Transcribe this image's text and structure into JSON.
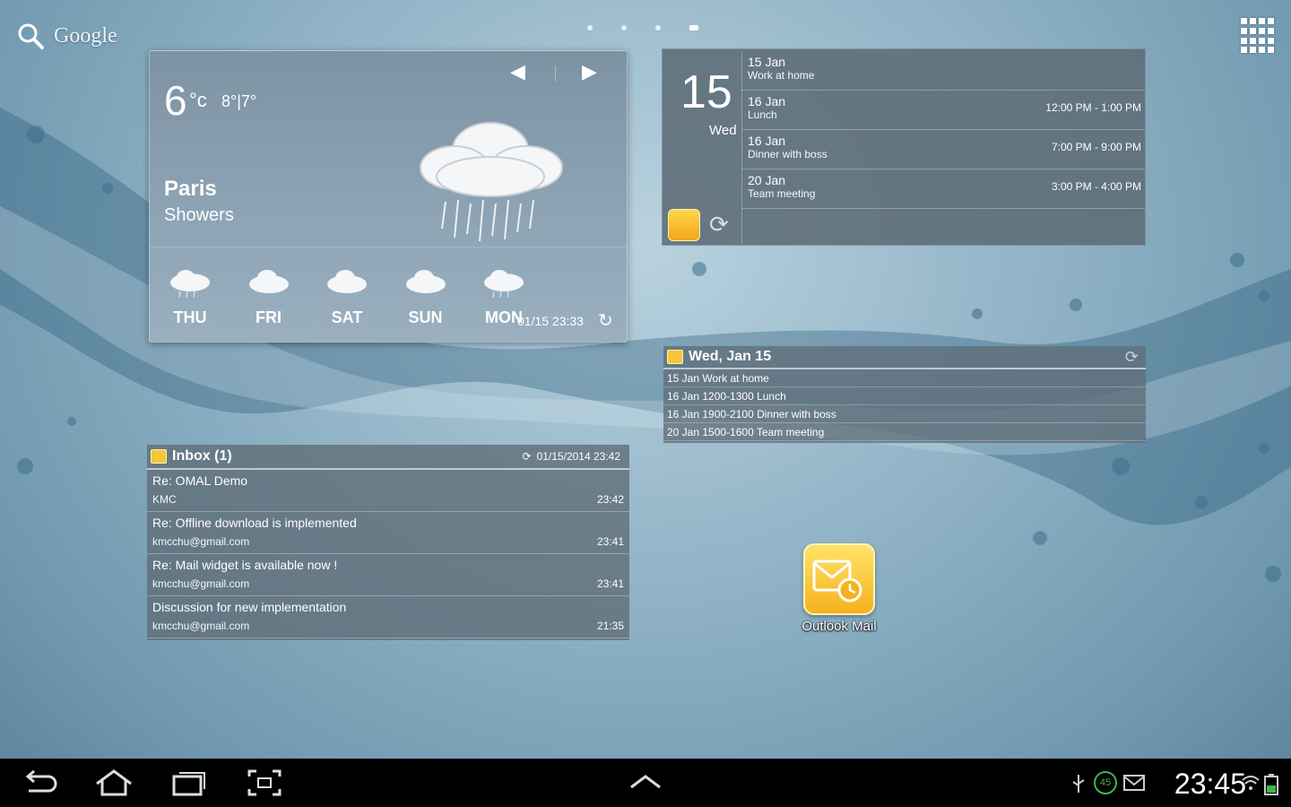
{
  "search": {
    "label": "Google"
  },
  "pages": {
    "count": 4,
    "active_index": 3
  },
  "weather": {
    "temperature": "6",
    "unit": "°c",
    "range": "8°|7°",
    "city": "Paris",
    "condition": "Showers",
    "updated": "01/15 23:33",
    "forecast": [
      {
        "day": "THU"
      },
      {
        "day": "FRI"
      },
      {
        "day": "SAT"
      },
      {
        "day": "SUN"
      },
      {
        "day": "MON"
      }
    ]
  },
  "calendar_agenda": {
    "day_number": "15",
    "day_name": "Wed",
    "events": [
      {
        "date": "15 Jan",
        "title": "Work at home",
        "time": ""
      },
      {
        "date": "16 Jan",
        "title": "Lunch",
        "time": "12:00 PM - 1:00 PM"
      },
      {
        "date": "16 Jan",
        "title": "Dinner with boss",
        "time": "7:00 PM - 9:00 PM"
      },
      {
        "date": "20 Jan",
        "title": "Team meeting",
        "time": "3:00 PM - 4:00 PM"
      }
    ]
  },
  "calendar_list": {
    "header": "Wed, Jan 15",
    "rows": [
      "15 Jan  Work at home",
      "16 Jan 1200-1300 Lunch",
      "16 Jan 1900-2100 Dinner with boss",
      "20 Jan 1500-1600 Team meeting"
    ]
  },
  "inbox": {
    "header": "Inbox (1)",
    "timestamp": "01/15/2014 23:42",
    "mails": [
      {
        "subject": "Re: OMAL Demo",
        "from": "KMC",
        "time": "23:42"
      },
      {
        "subject": "Re: Offline download is implemented",
        "from": "kmcchu@gmail.com",
        "time": "23:41"
      },
      {
        "subject": "Re: Mail widget is available now !",
        "from": "kmcchu@gmail.com",
        "time": "23:41"
      },
      {
        "subject": "Discussion for new implementation",
        "from": "kmcchu@gmail.com",
        "time": "21:35"
      }
    ]
  },
  "shortcut": {
    "label": "Outlook Mail"
  },
  "system_bar": {
    "clock": "23:45",
    "battery_level_badge": "45"
  },
  "colors": {
    "accent_yellow": "#f5c53a",
    "bar_bg": "#000000"
  }
}
